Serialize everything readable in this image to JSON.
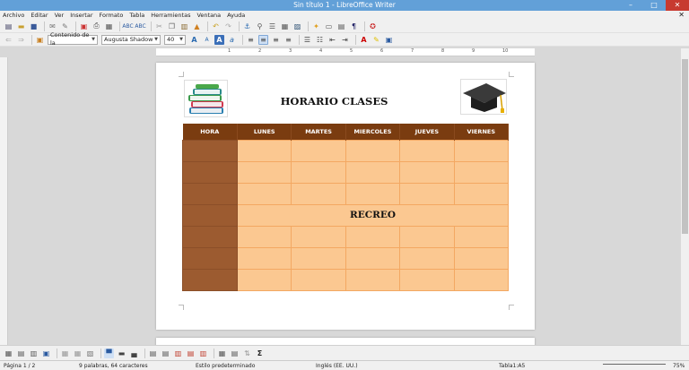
{
  "window": {
    "title": "Sin título 1 - LibreOffice Writer"
  },
  "menu": [
    "Archivo",
    "Editar",
    "Ver",
    "Insertar",
    "Formato",
    "Tabla",
    "Herramientas",
    "Ventana",
    "Ayuda"
  ],
  "formatting": {
    "paragraph_style": "Contenido de la",
    "font_name": "Augusta Shadow",
    "font_size": "40"
  },
  "ruler": {
    "ticks": [
      "1",
      "2",
      "3",
      "4",
      "5",
      "6",
      "7",
      "8",
      "9",
      "10"
    ]
  },
  "document": {
    "title": "HORARIO CLASES",
    "table": {
      "headers": [
        "HORA",
        "LUNES",
        "MARTES",
        "MIERCOLES",
        "JUEVES",
        "VIERNES"
      ],
      "break_label": "RECREO"
    }
  },
  "colors": {
    "header": "#7a3c10",
    "hour_col": "#9c5b30",
    "cell": "#fbc891",
    "cell_border": "#f3a862",
    "title_bar": "#62a0d8"
  },
  "status": {
    "page": "Página 1 / 2",
    "words": "9 palabras, 64 caracteres",
    "style": "Estilo predeterminado",
    "language": "Inglés (EE. UU.)",
    "cell": "Tabla1:A5",
    "zoom": "75%"
  }
}
